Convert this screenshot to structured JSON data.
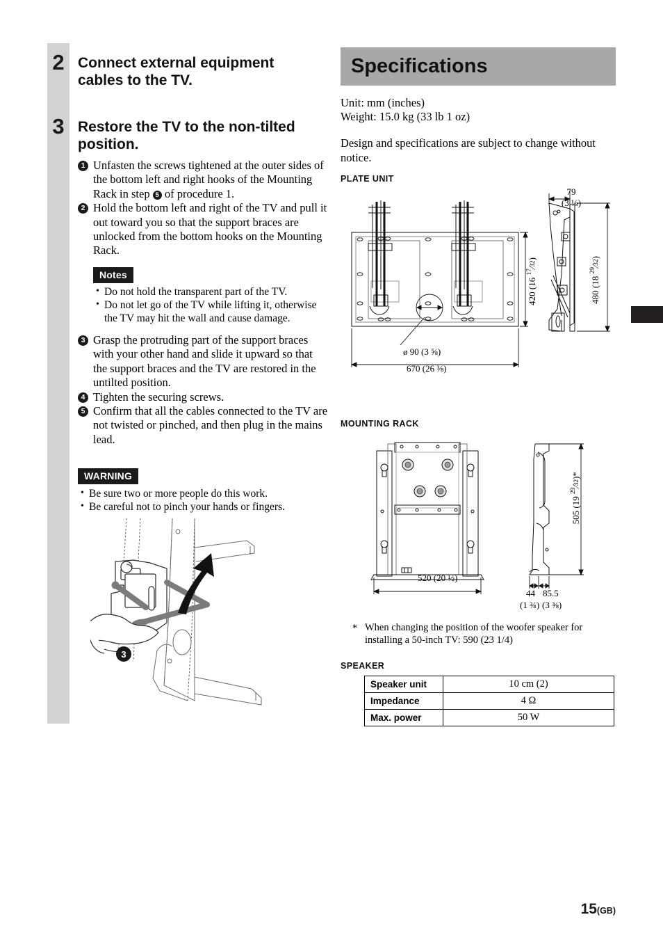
{
  "left_column": {
    "steps": [
      {
        "number": "2",
        "heading": "Connect external equipment cables to the TV."
      },
      {
        "number": "3",
        "heading": "Restore the TV to the non-tilted position."
      }
    ],
    "instructions": [
      {
        "num": "1",
        "text_a": "Unfasten the screws tightened at the outer sides of the bottom left and right hooks of the Mounting Rack in step ",
        "inline_num": "5",
        "text_b": " of procedure 1."
      },
      {
        "num": "2",
        "text_a": "Hold the bottom left and right of the TV and pull it out toward you so that the support braces are unlocked from the bottom hooks on the Mounting Rack.",
        "inline_num": "",
        "text_b": ""
      },
      {
        "num": "3",
        "text_a": "Grasp the protruding part of the support braces with your other hand and slide it upward so that the support braces and the TV are restored in the untilted position.",
        "inline_num": "",
        "text_b": ""
      },
      {
        "num": "4",
        "text_a": "Tighten the securing screws.",
        "inline_num": "",
        "text_b": ""
      },
      {
        "num": "5",
        "text_a": "Confirm that all the cables connected to the TV are not twisted or pinched, and then plug in the mains lead.",
        "inline_num": "",
        "text_b": ""
      }
    ],
    "notes": {
      "label": "Notes",
      "items": [
        "Do not hold the transparent part of the TV.",
        "Do not let go of the TV while lifting it, otherwise the TV may hit the wall and cause damage."
      ]
    },
    "warning": {
      "label": "WARNING",
      "items": [
        "Be sure two or more people do this work.",
        "Be careful not to pinch your hands or fingers."
      ]
    },
    "illustration": {
      "callout_number": "3"
    }
  },
  "right_column": {
    "title": "Specifications",
    "unit_line": "Unit: mm (inches)",
    "weight_line": "Weight: 15.0 kg (33 lb 1 oz)",
    "disclaimer": "Design and specifications are subject to change without notice.",
    "plate_unit": {
      "label": "PLATE UNIT",
      "dimensions": {
        "depth_mm": "79",
        "depth_in": "(3 ⅛)",
        "height_front": "420 (16 17/32)",
        "height_side": "480 (18 29/32)",
        "hole_diameter": "ø 90 (3 ⅝)",
        "width": "670 (26 ⅜)"
      }
    },
    "mounting_rack": {
      "label": "MOUNTING RACK",
      "dimensions": {
        "width": "520 (20 ½)",
        "height": "505 (19 29/32)*",
        "depth_a": "44",
        "depth_a_in": "(1 ¾)",
        "depth_b": "85.5",
        "depth_b_in": "(3 ⅜)"
      }
    },
    "footnote": {
      "marker": "*",
      "text": "When changing the position of the woofer speaker for installing a 50-inch TV: 590 (23 1/4)"
    },
    "speaker": {
      "label": "SPEAKER",
      "rows": [
        {
          "key": "Speaker unit",
          "value": "10 cm (2)"
        },
        {
          "key": "Impedance",
          "value": "4 Ω"
        },
        {
          "key": "Max. power",
          "value": "50 W"
        }
      ]
    }
  },
  "footer": {
    "page": "15",
    "region": "(GB)"
  },
  "colors": {
    "band_gray": "#d2d2d2",
    "spec_band": "#a8a8a8",
    "tag_black": "#1a1a1a"
  }
}
